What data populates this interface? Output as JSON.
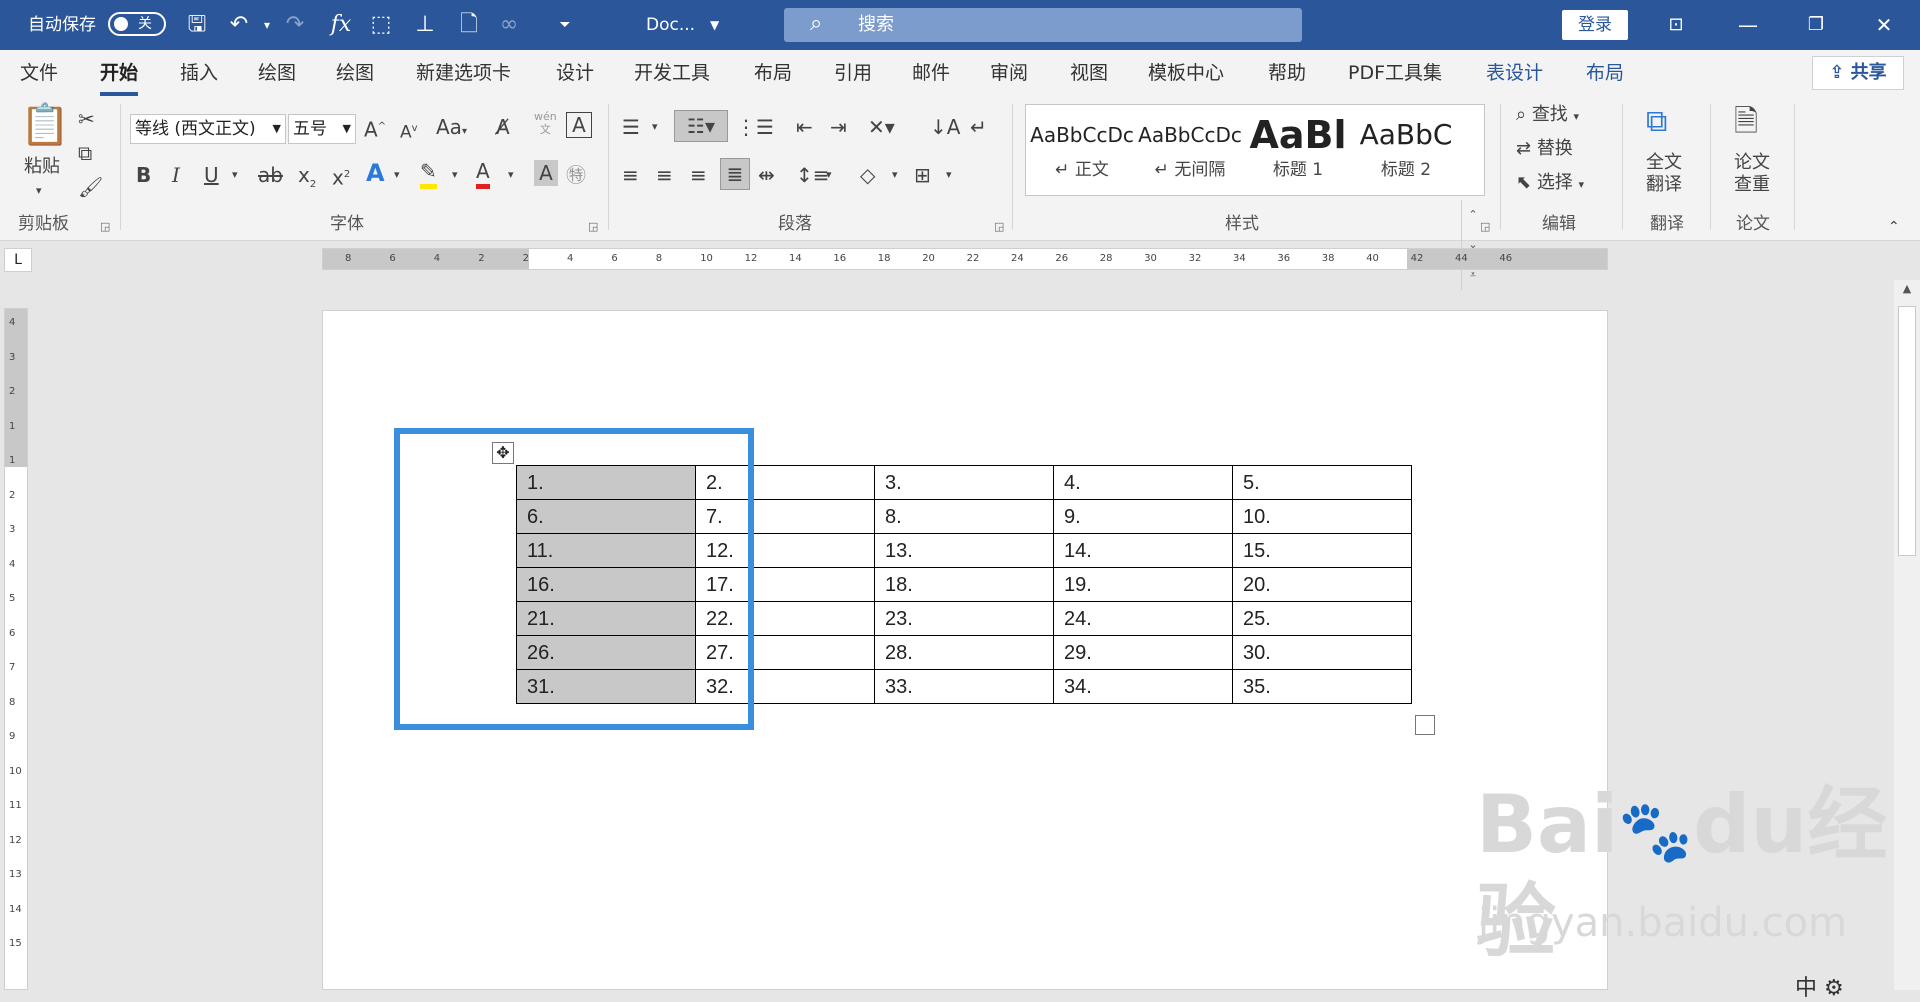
{
  "titlebar": {
    "autosave_label": "自动保存",
    "autosave_state": "关",
    "doc_title": "Doc...",
    "search_placeholder": "搜索",
    "login": "登录"
  },
  "menu": {
    "tabs": [
      "文件",
      "开始",
      "插入",
      "绘图",
      "绘图",
      "新建选项卡",
      "设计",
      "开发工具",
      "布局",
      "引用",
      "邮件",
      "审阅",
      "视图",
      "模板中心",
      "帮助",
      "PDF工具集",
      "表设计",
      "布局"
    ],
    "active": "开始",
    "share": "共享"
  },
  "ribbon": {
    "clipboard": {
      "paste": "粘贴",
      "label": "剪贴板"
    },
    "font": {
      "family": "等线 (西文正文)",
      "size": "五号",
      "label": "字体",
      "change_case": "Aa",
      "phonetic": "wén"
    },
    "paragraph": {
      "label": "段落"
    },
    "styles": {
      "label": "样式",
      "items": [
        {
          "preview": "AaBbCcDc",
          "name": "↵ 正文"
        },
        {
          "preview": "AaBbCcDc",
          "name": "↵ 无间隔"
        },
        {
          "preview": "AaBl",
          "name": "标题 1"
        },
        {
          "preview": "AaBbC",
          "name": "标题 2"
        }
      ]
    },
    "editing": {
      "find": "查找",
      "replace": "替换",
      "select": "选择",
      "label": "编辑"
    },
    "translate": {
      "button": "全文\n翻译",
      "label": "翻译"
    },
    "paper": {
      "button": "论文\n查重",
      "label": "论文"
    }
  },
  "ruler": {
    "marks": [
      "8",
      "6",
      "4",
      "2",
      "2",
      "4",
      "6",
      "8",
      "10",
      "12",
      "14",
      "16",
      "18",
      "20",
      "22",
      "24",
      "26",
      "28",
      "30",
      "32",
      "34",
      "36",
      "38",
      "40",
      "42",
      "44",
      "46"
    ],
    "vmarks": [
      "4",
      "3",
      "2",
      "1",
      "1",
      "2",
      "3",
      "4",
      "5",
      "6",
      "7",
      "8",
      "9",
      "10",
      "11",
      "12",
      "13",
      "14",
      "15"
    ]
  },
  "table": {
    "rows": [
      [
        "1.",
        "2.",
        "3.",
        "4.",
        "5."
      ],
      [
        "6.",
        "7.",
        "8.",
        "9.",
        "10."
      ],
      [
        "11.",
        "12.",
        "13.",
        "14.",
        "15."
      ],
      [
        "16.",
        "17.",
        "18.",
        "19.",
        "20."
      ],
      [
        "21.",
        "22.",
        "23.",
        "24.",
        "25."
      ],
      [
        "26.",
        "27.",
        "28.",
        "29.",
        "30."
      ],
      [
        "31.",
        "32.",
        "33.",
        "34.",
        "35."
      ]
    ],
    "selected_column": 0
  },
  "watermark": {
    "brand": "Bai",
    "brand2": "du",
    "cn": "经验",
    "url": "jingyan.baidu.com"
  },
  "colors": {
    "titlebar": "#2b579a",
    "highlight": "#3a8fdd",
    "selection": "#c8c8c8"
  }
}
